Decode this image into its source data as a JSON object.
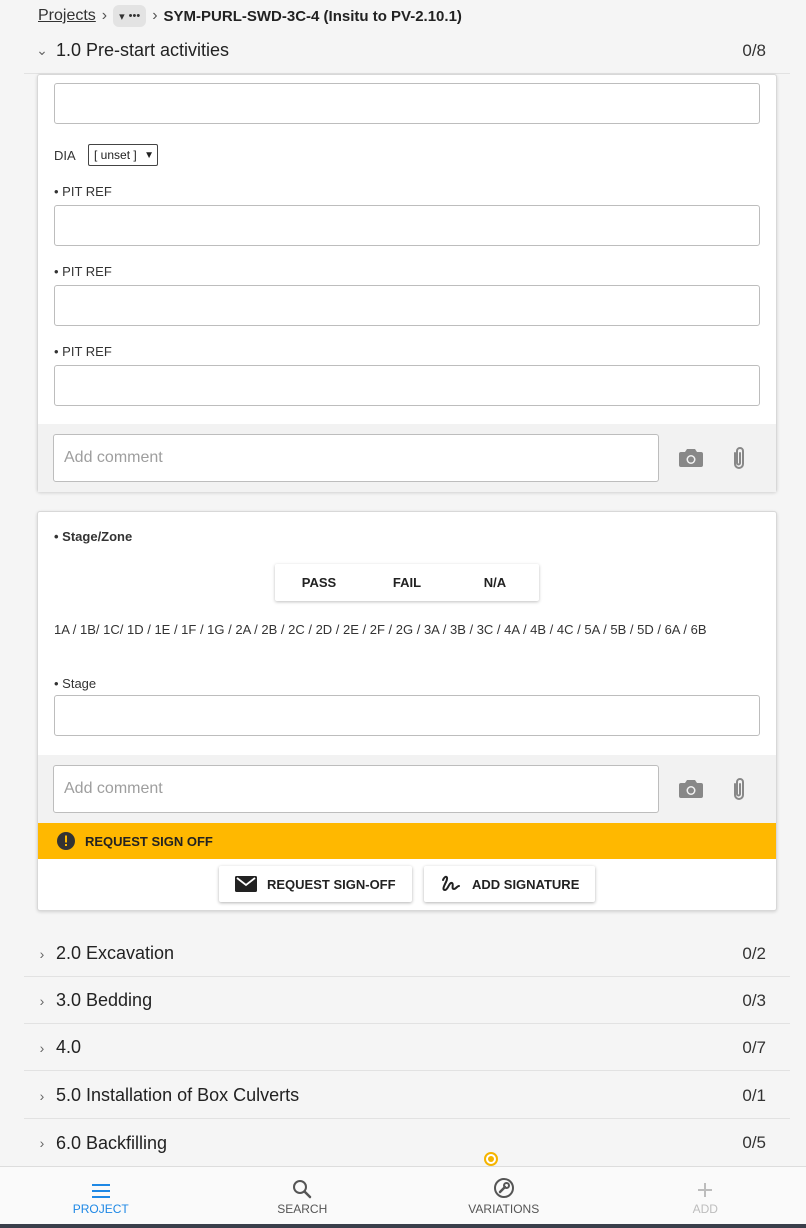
{
  "breadcrumb": {
    "projects_label": "Projects",
    "more_label": "•••",
    "title": "SYM-PURL-SWD-3C-4 (Insitu to PV-2.10.1)"
  },
  "open_section": {
    "title": "1.0 Pre-start activities",
    "count": "0/8"
  },
  "card1": {
    "dia_label": "DIA",
    "dia_value": "[ unset ]",
    "pit_ref_labels": [
      "• PIT REF",
      "• PIT REF",
      "• PIT REF"
    ],
    "comment_placeholder": "Add comment"
  },
  "card2": {
    "stage_zone_label": "• Stage/Zone",
    "pass_label": "PASS",
    "fail_label": "FAIL",
    "na_label": "N/A",
    "zones_text": "1A / 1B/ 1C/ 1D / 1E / 1F / 1G / 2A / 2B / 2C / 2D / 2E / 2F / 2G / 3A / 3B / 3C / 4A / 4B / 4C / 5A / 5B / 5D / 6A / 6B",
    "stage_label": "• Stage",
    "comment_placeholder": "Add comment",
    "banner_text": "REQUEST SIGN OFF",
    "request_signoff_label": "REQUEST SIGN-OFF",
    "add_signature_label": "ADD SIGNATURE"
  },
  "sections": [
    {
      "title": "2.0 Excavation",
      "count": "0/2"
    },
    {
      "title": "3.0 Bedding",
      "count": "0/3"
    },
    {
      "title": "4.0",
      "count": "0/7"
    },
    {
      "title": "5.0 Installation of Box Culverts",
      "count": "0/1"
    },
    {
      "title": "6.0 Backfilling",
      "count": "0/5"
    }
  ],
  "nav": {
    "project": "PROJECT",
    "search": "SEARCH",
    "variations": "VARIATIONS",
    "add": "ADD"
  },
  "colors": {
    "accent": "#1e88e5",
    "banner": "#ffb800",
    "indicator": "#f5b400"
  }
}
